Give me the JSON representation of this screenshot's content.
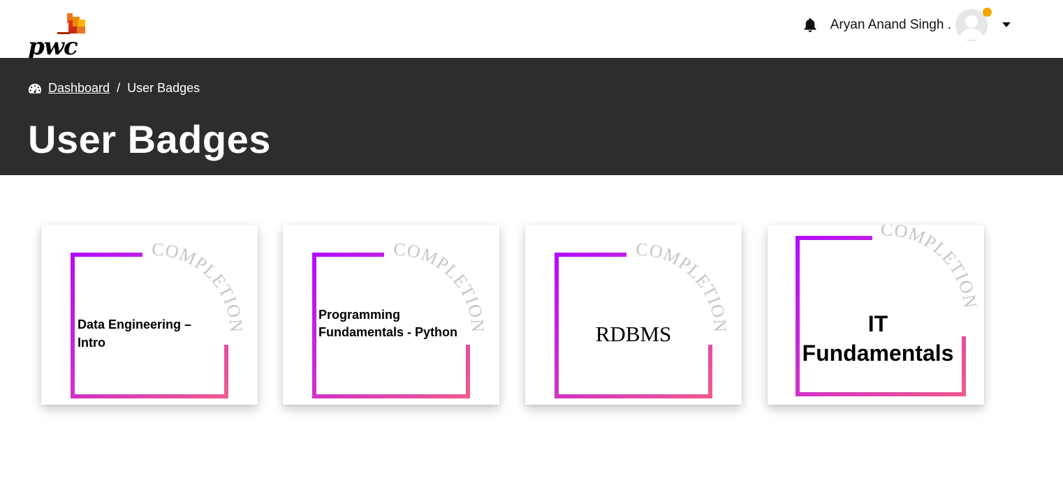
{
  "header": {
    "brand": "pwc",
    "user_name": "Aryan Anand Singh .",
    "status_color": "#f5a700",
    "icons": {
      "notifications": "bell-icon",
      "menu": "caret-down-icon"
    }
  },
  "breadcrumb": {
    "icon": "dashboard-gauge-icon",
    "home_label": "Dashboard",
    "separator": "/",
    "current": "User Badges"
  },
  "page": {
    "title": "User Badges"
  },
  "colors": {
    "banner": "#2d2d2d",
    "frame_start": "#b40cff",
    "frame_end": "#ef5a8f",
    "arc_text": "#c6c6c6"
  },
  "badges": [
    {
      "ribbon": "COMPLETION",
      "line1": "Data Engineering –",
      "line2": "Intro"
    },
    {
      "ribbon": "COMPLETION",
      "line1": "Programming",
      "line2": "Fundamentals - Python"
    },
    {
      "ribbon": "COMPLETION",
      "line1": "RDBMS"
    },
    {
      "ribbon": "COMPLETION",
      "line1": "IT",
      "line2": "Fundamentals"
    }
  ]
}
